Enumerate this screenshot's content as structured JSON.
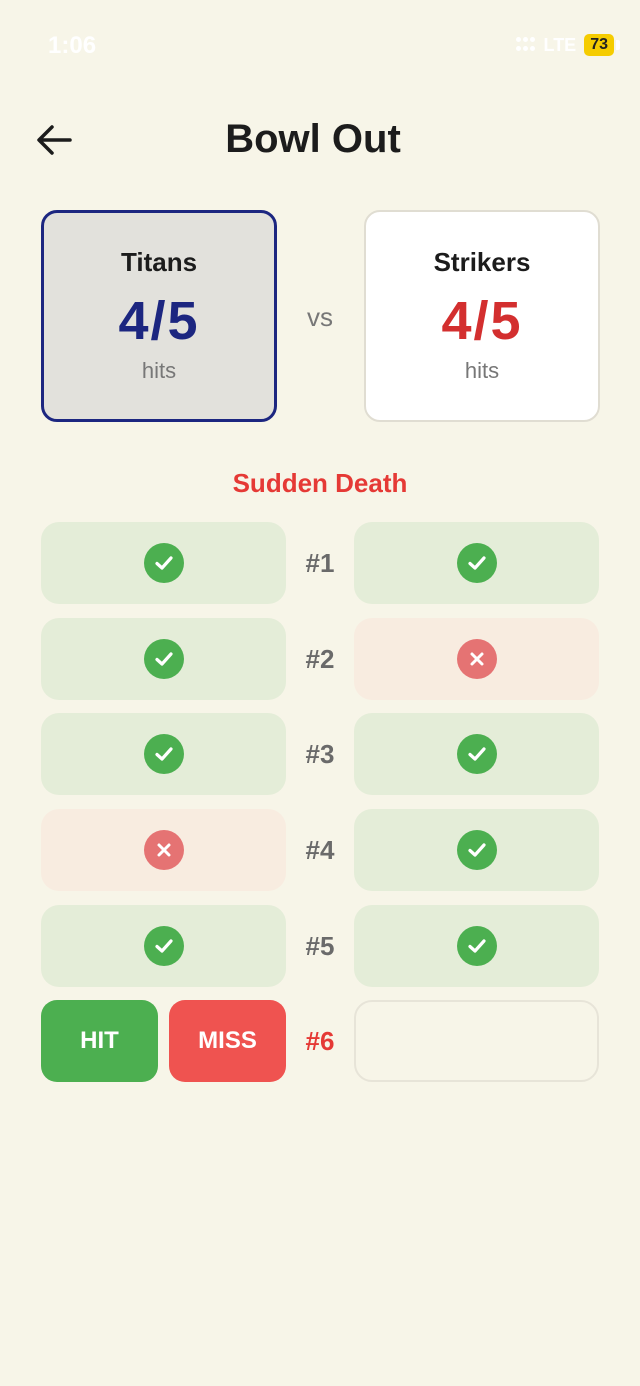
{
  "status": {
    "time": "1:06",
    "network": "LTE",
    "battery": "73"
  },
  "header": {
    "title": "Bowl Out"
  },
  "teams": [
    {
      "name": "Titans",
      "score": "4/5",
      "unit": "hits",
      "color": "#1c2680"
    },
    {
      "name": "Strikers",
      "score": "4/5",
      "unit": "hits",
      "color": "#d32f2f"
    }
  ],
  "vs_label": "vs",
  "phase_label": "Sudden Death",
  "rounds": [
    {
      "label": "#1",
      "team_a": "hit",
      "team_b": "hit"
    },
    {
      "label": "#2",
      "team_a": "hit",
      "team_b": "miss"
    },
    {
      "label": "#3",
      "team_a": "hit",
      "team_b": "hit"
    },
    {
      "label": "#4",
      "team_a": "miss",
      "team_b": "hit"
    },
    {
      "label": "#5",
      "team_a": "hit",
      "team_b": "hit"
    }
  ],
  "current_round": {
    "label": "#6",
    "hit_label": "HIT",
    "miss_label": "MISS"
  },
  "colors": {
    "hit": "#4caf50",
    "miss": "#ef5350",
    "accent": "#e53935"
  }
}
